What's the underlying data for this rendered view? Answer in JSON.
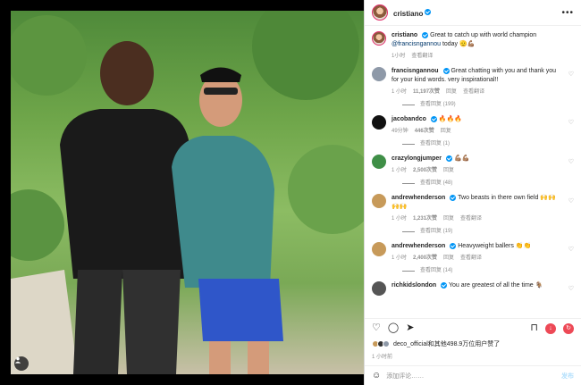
{
  "header": {
    "username": "cristiano",
    "more": "•••"
  },
  "caption": {
    "username": "cristiano",
    "text": "Great to catch up with world champion",
    "mention": "@francisngannou",
    "trail": "today 🫡💪🏽",
    "time": "1小时",
    "translate": "查看翻译"
  },
  "comments": [
    {
      "username": "francisngannou",
      "text": "Great chatting with you and thank you for your kind words. very inspirational!!",
      "time": "1 小时",
      "likes": "11,197次赞",
      "reply": "回复",
      "translate": "查看翻译",
      "replies": "查看回复 (199)",
      "avatar_color": "#8e99a8"
    },
    {
      "username": "jacobandco",
      "text": "🔥🔥🔥",
      "time": "49分钟",
      "likes": "446次赞",
      "reply": "回复",
      "translate": "",
      "replies": "查看回复 (1)",
      "avatar_color": "#111111"
    },
    {
      "username": "crazylongjumper",
      "text": "💪🏽💪🏽",
      "time": "1 小时",
      "likes": "2,500次赞",
      "reply": "回复",
      "translate": "",
      "replies": "查看回复 (48)",
      "avatar_color": "#3f8f47"
    },
    {
      "username": "andrewhenderson",
      "text": "Two beasts in there own field 🙌🙌🙌🙌",
      "time": "1 小时",
      "likes": "1,231次赞",
      "reply": "回复",
      "translate": "查看翻译",
      "replies": "查看回复 (19)",
      "avatar_color": "#c79a5a"
    },
    {
      "username": "andrewhenderson",
      "text": "Heavyweight ballers 👏👏",
      "time": "1 小时",
      "likes": "2,400次赞",
      "reply": "回复",
      "translate": "查看翻译",
      "replies": "查看回复 (14)",
      "avatar_color": "#c79a5a"
    },
    {
      "username": "richkidslondon",
      "text": "You are greatest of all the time 🐐",
      "time": "",
      "likes": "",
      "reply": "",
      "translate": "",
      "replies": "",
      "avatar_color": "#555555"
    }
  ],
  "likes_text": "deco_official和其他498.9万位用户赞了",
  "post_time": "1 小时前",
  "comment_input": {
    "placeholder": "添加评论……",
    "post": "发布"
  },
  "colors": {
    "verified": "#0095f6",
    "link": "#00376b",
    "muted": "#8e8e8e",
    "like_red": "#ed4956"
  }
}
